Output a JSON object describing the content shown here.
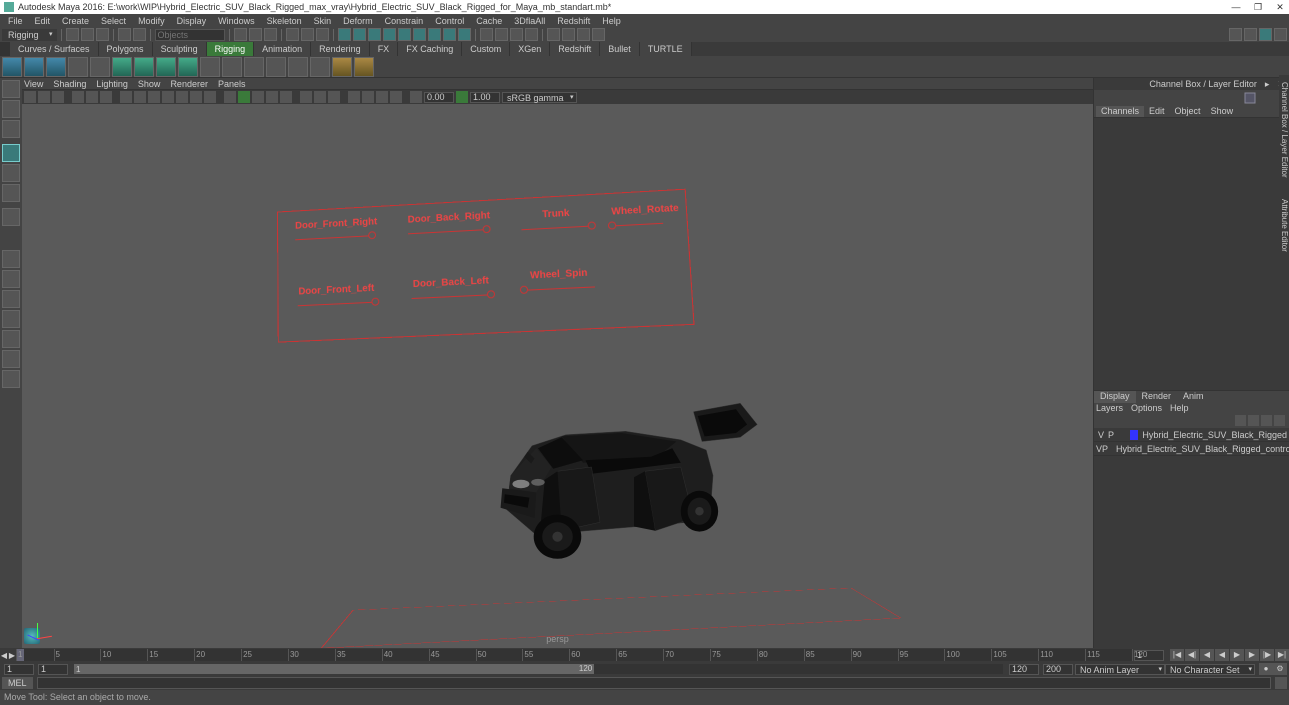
{
  "title": "Autodesk Maya 2016: E:\\work\\WIP\\Hybrid_Electric_SUV_Black_Rigged_max_vray\\Hybrid_Electric_SUV_Black_Rigged_for_Maya_mb_standart.mb*",
  "menubar": [
    "File",
    "Edit",
    "Create",
    "Select",
    "Modify",
    "Display",
    "Windows",
    "Skeleton",
    "Skin",
    "Deform",
    "Constrain",
    "Control",
    "Cache",
    "3DflaAll",
    "Redshift",
    "Help"
  ],
  "moduleDropdown": "Rigging",
  "shelfTabs": [
    "Curves / Surfaces",
    "Polygons",
    "Sculpting",
    "Rigging",
    "Animation",
    "Rendering",
    "FX",
    "FX Caching",
    "Custom",
    "XGen",
    "Redshift",
    "Bullet",
    "TURTLE"
  ],
  "shelfActive": 3,
  "inputLabel": "Objects",
  "viewportMenu": [
    "View",
    "Shading",
    "Lighting",
    "Show",
    "Renderer",
    "Panels"
  ],
  "gamma": "sRGB gamma",
  "gammaVal1": "0.00",
  "gammaVal2": "1.00",
  "viewportLabel": "persp",
  "controls": {
    "doorFrontRight": "Door_Front_Right",
    "doorBackRight": "Door_Back_Right",
    "trunk": "Trunk",
    "wheelRotate": "Wheel_Rotate",
    "doorFrontLeft": "Door_Front_Left",
    "doorBackLeft": "Door_Back_Left",
    "wheelSpin": "Wheel_Spin"
  },
  "rightPanel": {
    "title": "Channel Box / Layer Editor",
    "tabs": [
      "Channels",
      "Edit",
      "Object",
      "Show"
    ],
    "layerTabs": [
      "Display",
      "Render",
      "Anim"
    ],
    "layerMenu": [
      "Layers",
      "Options",
      "Help"
    ],
    "layers": [
      {
        "v": "V",
        "p": "P",
        "color": "#33f",
        "name": "Hybrid_Electric_SUV_Black_Rigged"
      },
      {
        "v": "V",
        "p": "P",
        "color": "#f33",
        "name": "Hybrid_Electric_SUV_Black_Rigged_controllers"
      }
    ],
    "sideTab1": "Channel Box / Layer Editor",
    "sideTab2": "Attribute Editor"
  },
  "timeline": {
    "start": "1",
    "current": "1",
    "rangeEnd": "120",
    "end": "200",
    "ticks": [
      1,
      5,
      10,
      15,
      20,
      25,
      30,
      35,
      40,
      45,
      50,
      55,
      60,
      65,
      70,
      75,
      80,
      85,
      90,
      95,
      100,
      105,
      110,
      115,
      120
    ],
    "animLayer": "No Anim Layer",
    "characterSet": "No Character Set"
  },
  "cmdLabel": "MEL",
  "statusText": "Move Tool: Select an object to move."
}
